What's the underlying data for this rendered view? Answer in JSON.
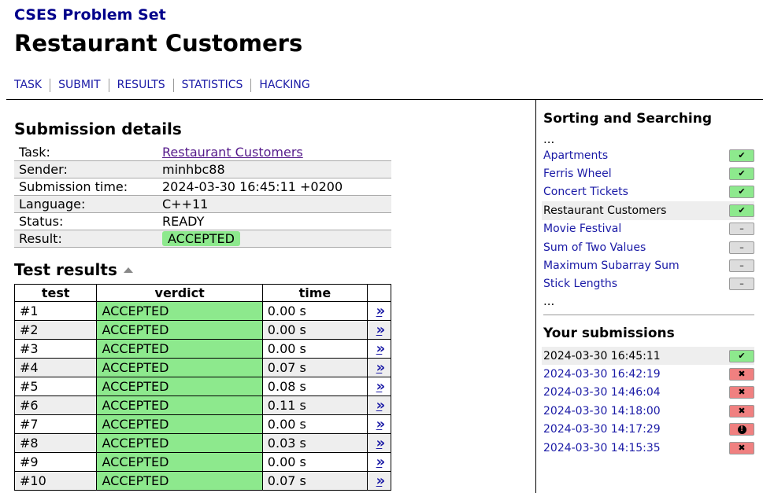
{
  "site": {
    "title": "CSES Problem Set"
  },
  "page": {
    "title": "Restaurant Customers"
  },
  "nav": [
    "TASK",
    "SUBMIT",
    "RESULTS",
    "STATISTICS",
    "HACKING"
  ],
  "details": {
    "heading": "Submission details",
    "rows": [
      {
        "key": "Task:",
        "value": "Restaurant Customers",
        "link": true
      },
      {
        "key": "Sender:",
        "value": "minhbc88"
      },
      {
        "key": "Submission time:",
        "value": "2024-03-30 16:45:11 +0200"
      },
      {
        "key": "Language:",
        "value": "C++11"
      },
      {
        "key": "Status:",
        "value": "READY"
      },
      {
        "key": "Result:",
        "value": "ACCEPTED",
        "badge": true
      }
    ]
  },
  "tests": {
    "heading": "Test results",
    "columns": [
      "test",
      "verdict",
      "time"
    ],
    "rows": [
      {
        "test": "#1",
        "verdict": "ACCEPTED",
        "time": "0.00 s"
      },
      {
        "test": "#2",
        "verdict": "ACCEPTED",
        "time": "0.00 s"
      },
      {
        "test": "#3",
        "verdict": "ACCEPTED",
        "time": "0.00 s"
      },
      {
        "test": "#4",
        "verdict": "ACCEPTED",
        "time": "0.07 s"
      },
      {
        "test": "#5",
        "verdict": "ACCEPTED",
        "time": "0.08 s"
      },
      {
        "test": "#6",
        "verdict": "ACCEPTED",
        "time": "0.11 s"
      },
      {
        "test": "#7",
        "verdict": "ACCEPTED",
        "time": "0.00 s"
      },
      {
        "test": "#8",
        "verdict": "ACCEPTED",
        "time": "0.03 s"
      },
      {
        "test": "#9",
        "verdict": "ACCEPTED",
        "time": "0.00 s"
      },
      {
        "test": "#10",
        "verdict": "ACCEPTED",
        "time": "0.07 s"
      }
    ],
    "detail_glyph": "»"
  },
  "sidebar": {
    "category": "Sorting and Searching",
    "ellipsis": "...",
    "tasks": [
      {
        "name": "Apartments",
        "status": "solved"
      },
      {
        "name": "Ferris Wheel",
        "status": "solved"
      },
      {
        "name": "Concert Tickets",
        "status": "solved"
      },
      {
        "name": "Restaurant Customers",
        "status": "solved",
        "current": true
      },
      {
        "name": "Movie Festival",
        "status": "unsolved"
      },
      {
        "name": "Sum of Two Values",
        "status": "unsolved"
      },
      {
        "name": "Maximum Subarray Sum",
        "status": "unsolved"
      },
      {
        "name": "Stick Lengths",
        "status": "unsolved"
      }
    ],
    "submissions_heading": "Your submissions",
    "submissions": [
      {
        "time": "2024-03-30 16:45:11",
        "status": "accepted",
        "current": true
      },
      {
        "time": "2024-03-30 16:42:19",
        "status": "wrong"
      },
      {
        "time": "2024-03-30 14:46:04",
        "status": "wrong"
      },
      {
        "time": "2024-03-30 14:18:00",
        "status": "wrong"
      },
      {
        "time": "2024-03-30 14:17:29",
        "status": "error"
      },
      {
        "time": "2024-03-30 14:15:35",
        "status": "wrong"
      }
    ]
  },
  "colors": {
    "accepted": "#8de98d",
    "wrong": "#f08080",
    "unsolved": "#dddddd",
    "link": "#1a1aa6"
  }
}
